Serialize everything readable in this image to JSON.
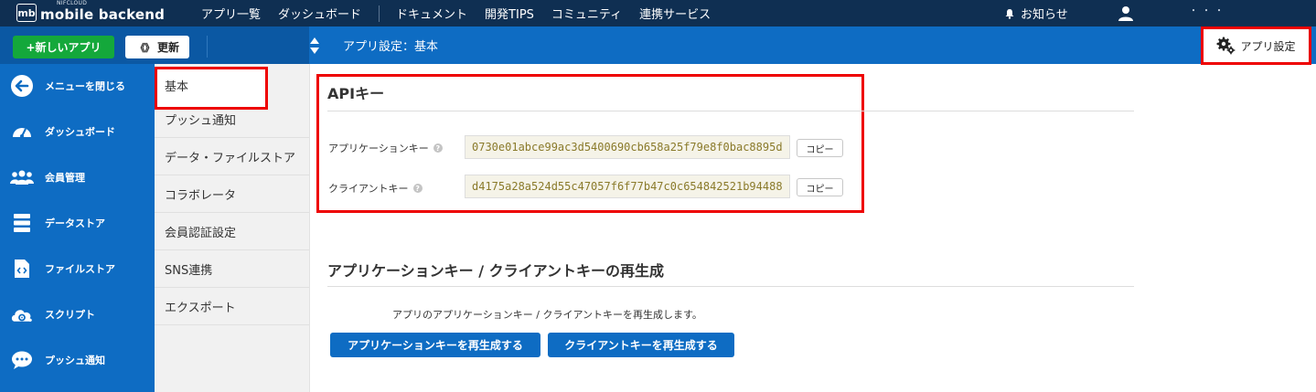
{
  "topnav": {
    "logo_mark": "mb",
    "logo_small": "NIFCLOUD",
    "logo_main": "mobile backend",
    "links": [
      "アプリ一覧",
      "ダッシュボード",
      "ドキュメント",
      "開発TIPS",
      "コミュニティ",
      "連携サービス"
    ],
    "notice": "お知らせ",
    "user_redacted": "・・・"
  },
  "toolbar": {
    "new_app": "+新しいアプリ",
    "refresh_icon": "《》",
    "refresh": "更新",
    "breadcrumb": "アプリ設定：基本",
    "app_settings": "アプリ設定"
  },
  "sidebar": {
    "items": [
      {
        "label": "メニューを閉じる",
        "icon": "arrow-left-circle-icon"
      },
      {
        "label": "ダッシュボード",
        "icon": "speedometer-icon"
      },
      {
        "label": "会員管理",
        "icon": "users-icon"
      },
      {
        "label": "データストア",
        "icon": "database-icon"
      },
      {
        "label": "ファイルストア",
        "icon": "file-code-icon"
      },
      {
        "label": "スクリプト",
        "icon": "cloud-gear-icon"
      },
      {
        "label": "プッシュ通知",
        "icon": "chat-bubble-icon"
      }
    ]
  },
  "subnav": {
    "items": [
      "基本",
      "プッシュ通知",
      "データ・ファイルストア",
      "コラボレータ",
      "会員認証設定",
      "SNS連携",
      "エクスポート"
    ]
  },
  "api": {
    "title": "APIキー",
    "help": "?",
    "app_key_label": "アプリケーションキー",
    "app_key_value": "0730e01abce99ac3d5400690cb658a25f79e8f0bac8895d",
    "client_key_label": "クライアントキー",
    "client_key_value": "d4175a28a524d55c47057f6f77b47c0c654842521b94488",
    "copy": "コピー"
  },
  "regen": {
    "title": "アプリケーションキー / クライアントキーの再生成",
    "description": "アプリのアプリケーションキー / クライアントキーを再生成します。",
    "app_key_button": "アプリケーションキーを再生成する",
    "client_key_button": "クライアントキーを再生成する"
  },
  "colors": {
    "nav_dark": "#0f2f52",
    "primary_blue": "#0e6cc3",
    "green": "#14a83b",
    "highlight_red": "#ee0000"
  }
}
